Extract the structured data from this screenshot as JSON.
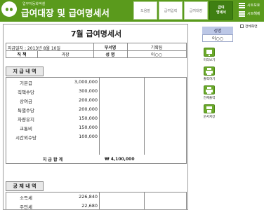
{
  "header": {
    "app_subtitle": "업무자동화엑셀",
    "app_title": "급여대장 및 급여명세서",
    "tabs": [
      {
        "label": "도움말"
      },
      {
        "label": "급여입력"
      },
      {
        "label": "급여대장"
      },
      {
        "label": "급여\n명세서"
      }
    ],
    "sheet_show": "시트보호",
    "sheet_release": "시트해제",
    "colors": {
      "brand": "#5a9a1c",
      "active_tab": "#3f7f12"
    }
  },
  "doc": {
    "title": "7월 급여명세서",
    "pay_date": "지급일자 : 2013년 8월 10일",
    "info": {
      "dept_label": "부서명",
      "dept_value": "기획팀",
      "position_label": "직   책",
      "position_value": "과장",
      "name_label": "성   명",
      "name_value": "이○○"
    },
    "earnings": {
      "header": "지 급 내 역",
      "items": [
        {
          "label": "기본급",
          "amount": "3,000,000"
        },
        {
          "label": "직책수당",
          "amount": "300,000"
        },
        {
          "label": "상여금",
          "amount": "200,000"
        },
        {
          "label": "특별수당",
          "amount": "200,000"
        },
        {
          "label": "차량유지",
          "amount": "150,000"
        },
        {
          "label": "교통비",
          "amount": "150,000"
        },
        {
          "label": "시간외수당",
          "amount": "100,000"
        }
      ],
      "total_label": "지 급 합 계",
      "total_value": "₩   4,100,000"
    },
    "deductions": {
      "header": "공 제 내 역",
      "items": [
        {
          "label": "소득세",
          "amount": "226,840"
        },
        {
          "label": "주민세",
          "amount": "22,680"
        }
      ]
    }
  },
  "panel": {
    "all_check_label": "전체화면",
    "name_header": "성명",
    "name_value": "이○○",
    "buttons": [
      {
        "label": "미리보기",
        "icon": "monitor-icon"
      },
      {
        "label": "출력하기",
        "icon": "printer-icon"
      },
      {
        "label": "전체출력",
        "icon": "print-all-icon"
      },
      {
        "label": "문서저장",
        "icon": "save-icon"
      }
    ]
  }
}
